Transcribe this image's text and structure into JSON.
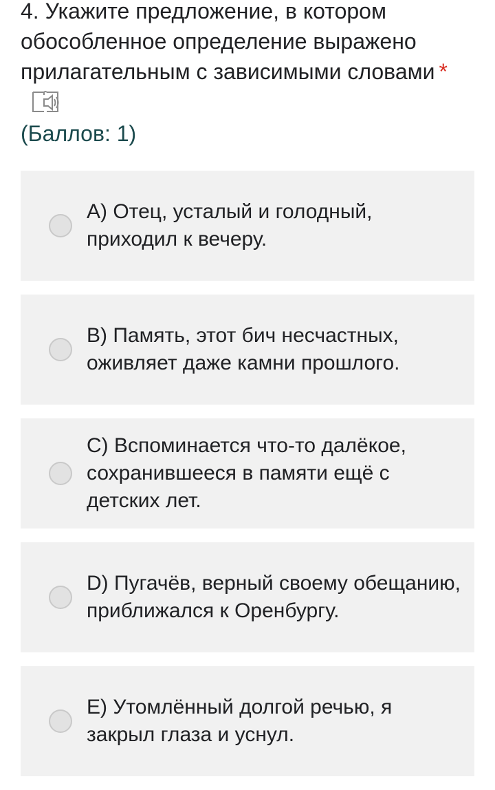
{
  "question": {
    "title": "4. Укажите предложение, в котором обособленное определение выражено прилагательным с зависимыми словами",
    "required_mark": "*",
    "tts_icon": "text-to-speech-icon",
    "points": "(Баллов: 1)",
    "points_color": "#1b4a4d",
    "required_color": "#d93025"
  },
  "options": [
    {
      "label": "A) Отец, усталый и голодный, приходил к вечеру.",
      "selected": false
    },
    {
      "label": "B) Память, этот бич несчастных, оживляет даже камни прошлого.",
      "selected": false
    },
    {
      "label": "C) Вспоминается что-то далёкое, сохранившееся в памяти ещё с детских лет.",
      "selected": false
    },
    {
      "label": "D) Пугачёв, верный своему обещанию, приближался к Оренбургу.",
      "selected": false
    },
    {
      "label": "E) Утомлённый долгой речью, я закрыл глаза и уснул.",
      "selected": false
    }
  ]
}
